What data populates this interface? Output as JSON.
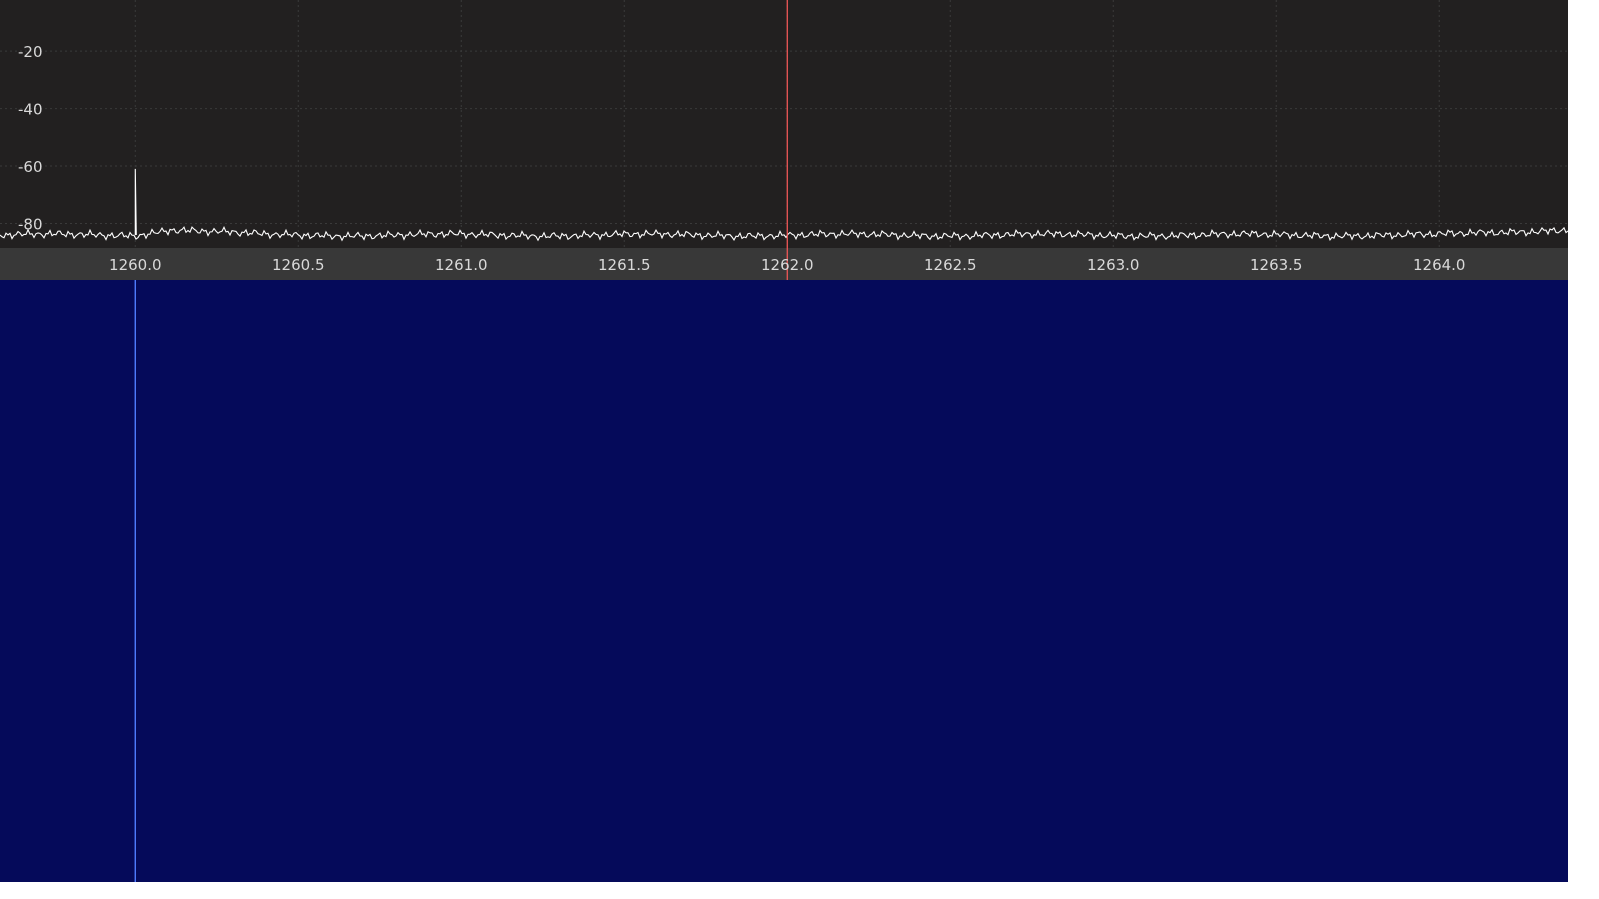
{
  "colors": {
    "spectrum_bg": "#222020",
    "axis_strip_bg": "#383838",
    "grid": "#3a3a3a",
    "trace": "#ffffff",
    "tuning_line": "#ff5a5a",
    "waterfall_bg": "#050a5a",
    "signal_line": "#4f7dff"
  },
  "axes": {
    "y": {
      "ticks": [
        "-20",
        "-40",
        "-60",
        "-80"
      ],
      "values": [
        -20,
        -40,
        -60,
        -80
      ]
    },
    "x": {
      "ticks": [
        "1260.0",
        "1260.5",
        "1261.0",
        "1261.5",
        "1262.0",
        "1262.5",
        "1263.0",
        "1263.5",
        "1264.0"
      ],
      "values": [
        1260.0,
        1260.5,
        1261.0,
        1261.5,
        1262.0,
        1262.5,
        1263.0,
        1263.5,
        1264.0
      ]
    }
  },
  "chart_data": {
    "type": "line",
    "xlim": [
      1259.585,
      1264.395
    ],
    "ylim": [
      -5,
      -84
    ],
    "series": [
      {
        "x": [
          1259.6,
          1260.0,
          1260.0,
          1260.0,
          1260.11,
          1260.4,
          1260.8,
          1261.2,
          1261.6,
          1262.0,
          1262.4,
          1262.8,
          1263.2,
          1263.6,
          1264.0,
          1264.38
        ],
        "y": [
          -84,
          -84,
          -61,
          -84,
          -82,
          -84,
          -84,
          -84,
          -84,
          -84,
          -84,
          -84,
          -84,
          -84,
          -84,
          -82
        ]
      }
    ]
  },
  "markers": {
    "tuning_frequency": 1262.0,
    "signal_frequency": 1260.0
  }
}
